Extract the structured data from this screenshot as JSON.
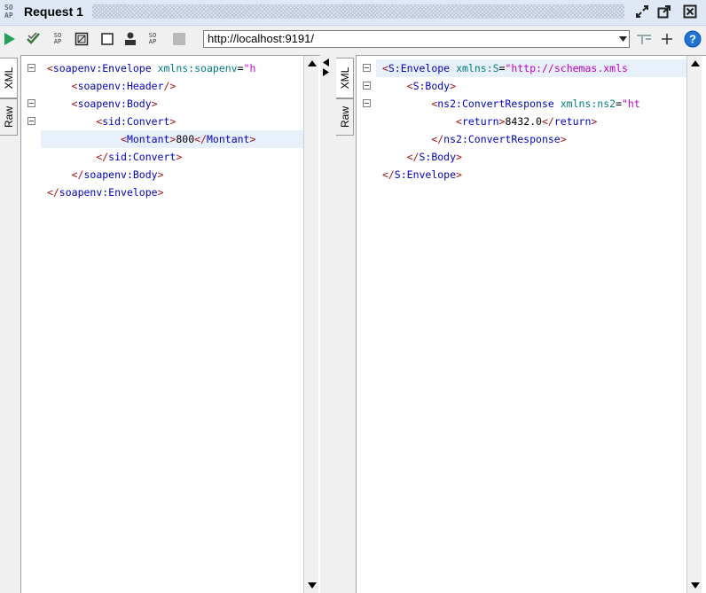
{
  "window": {
    "title": "Request 1",
    "soap_logo": "SO\nAP",
    "buttons": [
      "restore-icon",
      "maximize-icon",
      "close-icon"
    ]
  },
  "toolbar": {
    "url": "http://localhost:9191/",
    "icons": [
      "run-icon",
      "validate-icon",
      "soap-icon",
      "window-icon",
      "checkbox-icon",
      "user-icon",
      "soap-icon",
      "stop-icon",
      "settings-icon",
      "add-icon",
      "help-icon"
    ]
  },
  "request": {
    "tabs": [
      "XML",
      "Raw"
    ],
    "lines": [
      {
        "fold": true,
        "indent": 0,
        "parts": [
          [
            "br",
            "<"
          ],
          [
            "tag",
            "soapenv:Envelope"
          ],
          [
            "txt",
            " "
          ],
          [
            "attr",
            "xmlns:soapenv"
          ],
          [
            "eq",
            "="
          ],
          [
            "val",
            "\"h"
          ]
        ]
      },
      {
        "fold": false,
        "indent": 1,
        "parts": [
          [
            "br",
            "<"
          ],
          [
            "tag",
            "soapenv:Header"
          ],
          [
            "br",
            "/>"
          ]
        ]
      },
      {
        "fold": true,
        "indent": 1,
        "parts": [
          [
            "br",
            "<"
          ],
          [
            "tag",
            "soapenv:Body"
          ],
          [
            "br",
            ">"
          ]
        ]
      },
      {
        "fold": true,
        "indent": 2,
        "parts": [
          [
            "br",
            "<"
          ],
          [
            "tag",
            "sid:Convert"
          ],
          [
            "br",
            ">"
          ]
        ]
      },
      {
        "fold": false,
        "indent": 3,
        "highlight": true,
        "parts": [
          [
            "br",
            "<"
          ],
          [
            "tag",
            "Montant"
          ],
          [
            "br",
            ">"
          ],
          [
            "txt",
            "800"
          ],
          [
            "br",
            "</"
          ],
          [
            "tag",
            "Montant"
          ],
          [
            "br",
            ">"
          ]
        ]
      },
      {
        "fold": false,
        "indent": 2,
        "parts": [
          [
            "br",
            "</"
          ],
          [
            "tag",
            "sid:Convert"
          ],
          [
            "br",
            ">"
          ]
        ]
      },
      {
        "fold": false,
        "indent": 1,
        "parts": [
          [
            "br",
            "</"
          ],
          [
            "tag",
            "soapenv:Body"
          ],
          [
            "br",
            ">"
          ]
        ]
      },
      {
        "fold": false,
        "indent": 0,
        "parts": [
          [
            "br",
            "</"
          ],
          [
            "tag",
            "soapenv:Envelope"
          ],
          [
            "br",
            ">"
          ]
        ]
      }
    ]
  },
  "response": {
    "tabs": [
      "XML",
      "Raw"
    ],
    "lines": [
      {
        "fold": true,
        "indent": 0,
        "highlight": true,
        "parts": [
          [
            "br",
            "<"
          ],
          [
            "tag",
            "S:Envelope"
          ],
          [
            "txt",
            " "
          ],
          [
            "attr",
            "xmlns:S"
          ],
          [
            "eq",
            "="
          ],
          [
            "val",
            "\"http://schemas.xmls"
          ]
        ]
      },
      {
        "fold": true,
        "indent": 1,
        "parts": [
          [
            "br",
            "<"
          ],
          [
            "tag",
            "S:Body"
          ],
          [
            "br",
            ">"
          ]
        ]
      },
      {
        "fold": true,
        "indent": 2,
        "parts": [
          [
            "br",
            "<"
          ],
          [
            "tag",
            "ns2:ConvertResponse"
          ],
          [
            "txt",
            " "
          ],
          [
            "attr",
            "xmlns:ns2"
          ],
          [
            "eq",
            "="
          ],
          [
            "val",
            "\"ht"
          ]
        ]
      },
      {
        "fold": false,
        "indent": 3,
        "parts": [
          [
            "br",
            "<"
          ],
          [
            "tag",
            "return"
          ],
          [
            "br",
            ">"
          ],
          [
            "txt",
            "8432.0"
          ],
          [
            "br",
            "</"
          ],
          [
            "tag",
            "return"
          ],
          [
            "br",
            ">"
          ]
        ]
      },
      {
        "fold": false,
        "indent": 2,
        "parts": [
          [
            "br",
            "</"
          ],
          [
            "tag",
            "ns2:ConvertResponse"
          ],
          [
            "br",
            ">"
          ]
        ]
      },
      {
        "fold": false,
        "indent": 1,
        "parts": [
          [
            "br",
            "</"
          ],
          [
            "tag",
            "S:Body"
          ],
          [
            "br",
            ">"
          ]
        ]
      },
      {
        "fold": false,
        "indent": 0,
        "parts": [
          [
            "br",
            "</"
          ],
          [
            "tag",
            "S:Envelope"
          ],
          [
            "br",
            ">"
          ]
        ]
      }
    ]
  },
  "colors": {
    "highlight_line": "#e8f0fc",
    "tag": "#0000cc",
    "bracket": "#a31515",
    "attr": "#008080",
    "value": "#c000c0",
    "run_green": "#22a05a",
    "help_blue": "#1e73d8"
  }
}
